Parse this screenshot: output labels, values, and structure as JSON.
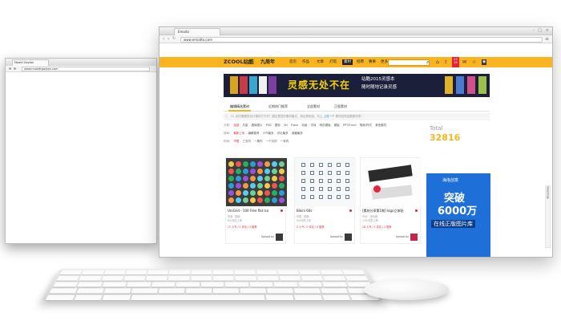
{
  "back_window": {
    "tab": "Moaid Gaytan",
    "url": "www.muaidtgaytan.com"
  },
  "main_window": {
    "tab": "Emaito",
    "url": "www.emiatto.com",
    "menu_icon": "hamburger-menu-icon"
  },
  "nav": {
    "logo": "ZCOOL站酷",
    "anniversary": "九周年",
    "items": [
      "首页",
      "作品",
      "文章",
      "灯塔",
      "素材",
      "招聘",
      "赛事",
      "活动",
      "更多"
    ],
    "active_index": 4,
    "badge_top": "43",
    "badge_bottom": "16",
    "icons": [
      "home-icon",
      "search-icon",
      "upload-icon",
      "star-icon",
      "user-icon"
    ]
  },
  "banner": {
    "main": "灵感无处不在",
    "sub1": "站酷2015灵感本",
    "sub2": "随时随地记录灵感"
  },
  "section_tabs": [
    {
      "label": "编辑精选素材",
      "active": true
    },
    {
      "label": "近期热门推荐",
      "active": false
    },
    {
      "label": "全部素材",
      "active": false
    },
    {
      "label": "正版素材",
      "active": false
    }
  ],
  "notice": {
    "icon": "info-icon",
    "text": "Hi, 亲们需要的设计素材打不开？建议是您的素材格式，请否是系统。马上",
    "link": "上传一个",
    "tail": "素材回馈站酷素材吧~"
  },
  "filters": [
    {
      "label": "分类:",
      "items": [
        "全部",
        "矢量",
        "图库图片",
        "PSD",
        "图标",
        "3D",
        "Flash",
        "动画",
        "字体",
        "网页模板",
        "模板",
        "PPT/Excel",
        "笔刷/样式",
        "其他素材"
      ],
      "active_index": 0
    },
    {
      "label": "排序:",
      "items": [
        "最新上传",
        "编辑推荐",
        "人气最多",
        "评论最多",
        "收藏最多"
      ],
      "active_index": 0
    },
    {
      "label": "时间:",
      "items": [
        "不限",
        "三天内",
        "一周内",
        "一个月内",
        "一年内"
      ],
      "active_index": 0
    }
  ],
  "total": {
    "label": "Total",
    "value": "32816"
  },
  "cards": [
    {
      "title": "UniGrid - 100 Free flat Ico",
      "meta1": "矢量 - 图标",
      "meta2": "8小时前上传",
      "stats": "17 人气 / 0 评论 / 3 推荐",
      "uploaded": "Upload by"
    },
    {
      "title": "Bikini 60s",
      "meta1": "矢量 - 图标",
      "meta2": "9小时前上传",
      "stats": "2 人气 / 0 评论 / 0 推荐",
      "uploaded": "Upload by"
    },
    {
      "title": "[素材分享第1期] logo立体贴",
      "meta1": "PSD - 设计稿",
      "meta2": "13小时前上传",
      "stats": "28 人气 / 0 评论 / 2 推荐",
      "uploaded": "Upload by"
    }
  ],
  "ad": {
    "logo": "海洛创意",
    "line1": "突破",
    "line2": "6000万",
    "line3": "在线正版图片库"
  },
  "side_scroll": [
    "返",
    "回",
    "顶",
    "部"
  ]
}
